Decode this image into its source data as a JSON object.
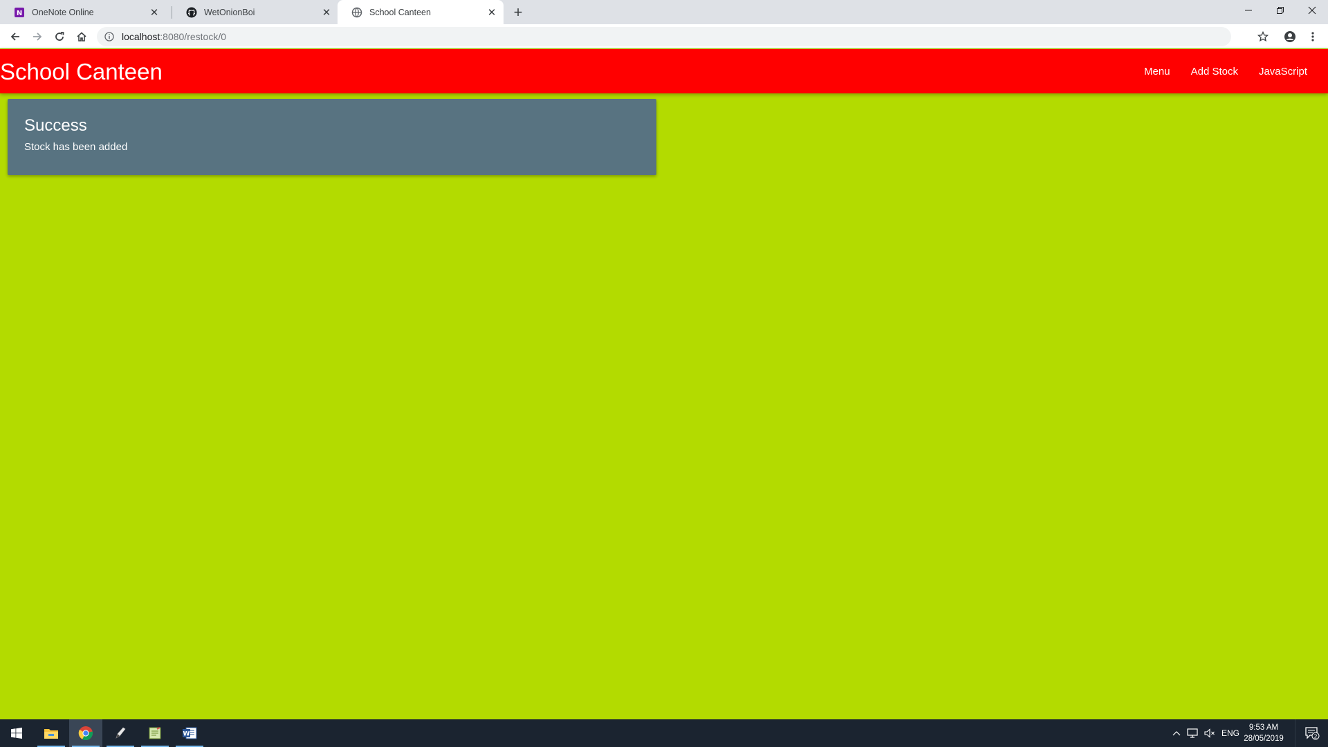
{
  "browser": {
    "tabs": [
      {
        "title": "OneNote Online",
        "icon": "onenote-icon",
        "active": false
      },
      {
        "title": "WetOnionBoi",
        "icon": "github-icon",
        "active": false
      },
      {
        "title": "School Canteen",
        "icon": "globe-icon",
        "active": true
      }
    ],
    "url_host": "localhost",
    "url_path": ":8080/restock/0"
  },
  "page": {
    "brand": "School Canteen",
    "nav_links": [
      "Menu",
      "Add Stock",
      "JavaScript"
    ],
    "alert": {
      "title": "Success",
      "message": "Stock has been added"
    },
    "colors": {
      "background": "#b3db00",
      "navbar": "#ff0000",
      "card": "#587381"
    }
  },
  "taskbar": {
    "apps": [
      "windows-start",
      "file-explorer",
      "chrome",
      "pen-app",
      "notepad-app",
      "word"
    ],
    "language": "ENG",
    "time": "9:53 AM",
    "date": "28/05/2019",
    "notification_count": "2"
  }
}
